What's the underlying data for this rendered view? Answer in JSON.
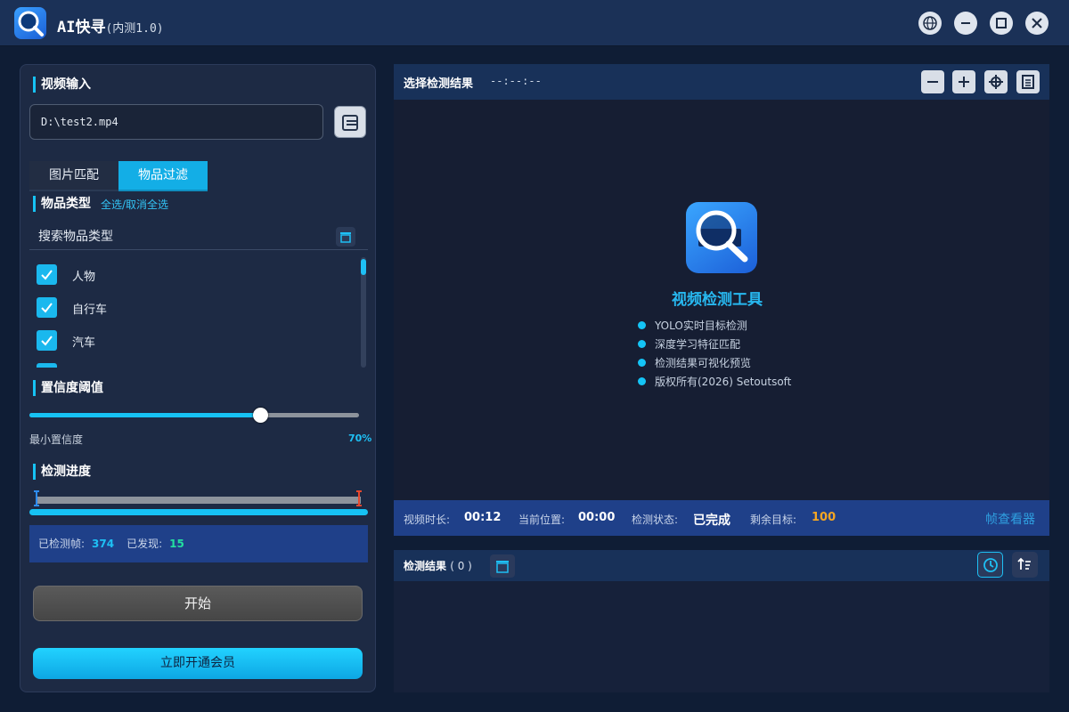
{
  "window": {
    "title": "AI快寻",
    "subtitle": "(内测1.0)",
    "icons": [
      "globe-icon",
      "minimize-icon",
      "maximize-icon",
      "close-icon"
    ]
  },
  "left": {
    "video_input": {
      "title": "视频输入",
      "path": "D:\\test2.mp4"
    },
    "tabs": [
      {
        "label": "图片匹配",
        "active": false
      },
      {
        "label": "物品过滤",
        "active": true
      }
    ],
    "categories": {
      "title": "物品类型",
      "select_all": "全选/取消全选",
      "search_placeholder": "搜索物品类型",
      "items": [
        {
          "label": "人物",
          "checked": true
        },
        {
          "label": "自行车",
          "checked": true
        },
        {
          "label": "汽车",
          "checked": true
        }
      ]
    },
    "confidence": {
      "title": "置信度阈值",
      "label": "最小置信度",
      "value": 70,
      "value_text": "70%"
    },
    "progress": {
      "title": "检测进度",
      "fraction": 1.0,
      "frames_label": "已检测帧:",
      "frames_value": "374",
      "found_label": "已发现:",
      "found_value": "15"
    },
    "start_button": "开始",
    "vip_button": "立即开通会员"
  },
  "preview": {
    "title": "选择检测结果",
    "time": "--:--:--",
    "tool_name": "视频检测工具",
    "features": [
      "YOLO实时目标检测",
      "深度学习特征匹配",
      "检测结果可视化预览",
      "版权所有(2026) Setoutsoft"
    ]
  },
  "status": {
    "duration_label": "视频时长:",
    "duration_value": "00:12",
    "position_label": "当前位置:",
    "position_value": "00:00",
    "state_label": "检测状态:",
    "state_value": "已完成",
    "remaining_label": "剩余目标:",
    "remaining_value": "100",
    "frame_viewer": "帧查看器"
  },
  "results": {
    "title": "检测结果",
    "count": "( 0 )"
  },
  "colors": {
    "accent": "#16c2f4",
    "remaining": "#f5a623",
    "found": "#23e0a0"
  }
}
